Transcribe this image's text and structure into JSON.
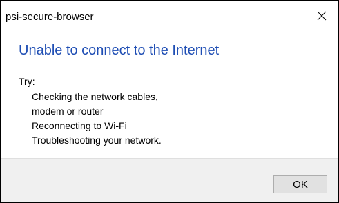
{
  "window": {
    "title": "psi-secure-browser",
    "close_icon": "close-icon"
  },
  "message": {
    "heading": "Unable to connect to the Internet",
    "try_label": "Try:",
    "suggestions": [
      "Checking the network cables,",
      "modem or router",
      "Reconnecting to Wi-Fi",
      "Troubleshooting your network."
    ]
  },
  "footer": {
    "ok_label": "OK"
  },
  "colors": {
    "heading": "#1f4eb4",
    "footer_background": "#f0f0f0",
    "button_background": "#e1e1e1",
    "button_border": "#adadad"
  }
}
